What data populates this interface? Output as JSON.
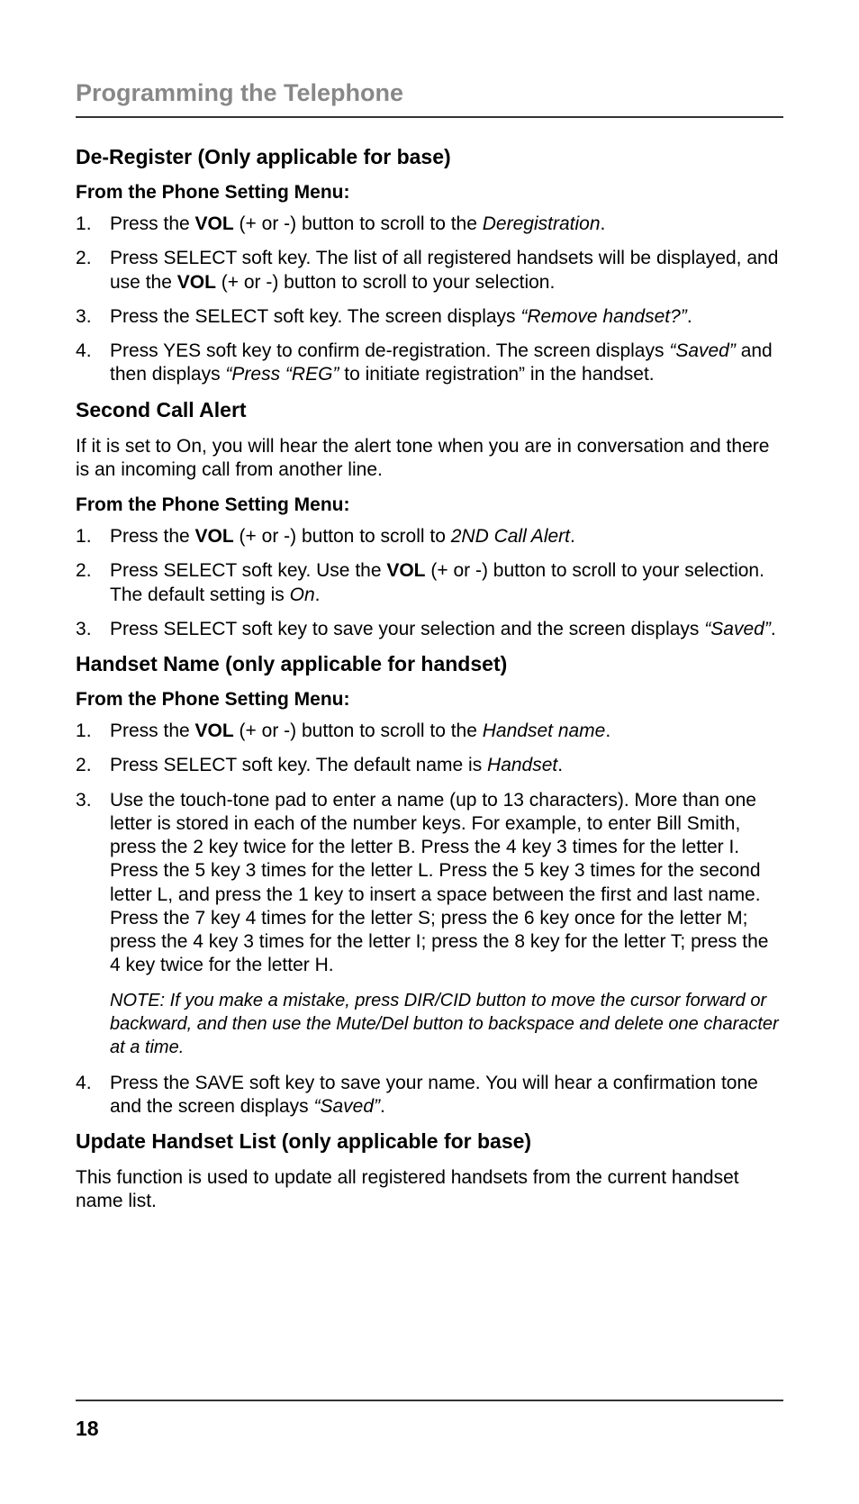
{
  "header": "Programming the Telephone",
  "section1": {
    "title": "De-Register (Only applicable for base)",
    "subhead": "From the Phone Setting Menu:",
    "s1_pre": "Press the ",
    "s1_vol": "VOL",
    "s1_mid": " (+ or -) button to scroll to the ",
    "s1_ital": "Deregistration",
    "s1_end": ".",
    "s2_pre": "Press SELECT soft key. The list of all registered handsets will be displayed, and use the ",
    "s2_vol": "VOL",
    "s2_end": " (+ or -) button to scroll to your selection.",
    "s3_pre": "Press the SELECT soft key. The screen displays ",
    "s3_ital": "“Remove handset?”",
    "s3_end": ".",
    "s4_pre": "Press YES soft key to confirm de-registration. The screen displays ",
    "s4_i1": "“Saved”",
    "s4_mid": " and then displays ",
    "s4_i2": "“Press “REG”",
    "s4_end": " to initiate registration” in the handset."
  },
  "section2": {
    "title": "Second Call Alert",
    "intro": "If it is set to On, you will hear the alert tone when you are in conversation and there is an incoming call from another line.",
    "subhead": "From the Phone Setting Menu:",
    "s1_pre": "Press the ",
    "s1_vol": "VOL",
    "s1_mid": " (+ or -) button to scroll to ",
    "s1_ital": "2ND Call Alert",
    "s1_end": ".",
    "s2_pre": "Press SELECT soft key. Use the ",
    "s2_vol": "VOL",
    "s2_mid": " (+ or -) button to scroll to your selection. The default setting is ",
    "s2_ital": "On",
    "s2_end": ".",
    "s3_pre": "Press SELECT soft key to save your selection and the screen displays ",
    "s3_ital": "“Saved”",
    "s3_end": "."
  },
  "section3": {
    "title": "Handset Name (only applicable for handset)",
    "subhead": "From the Phone Setting Menu:",
    "s1_pre": "Press the ",
    "s1_vol": "VOL",
    "s1_mid": " (+ or -) button to scroll to the ",
    "s1_ital": "Handset name",
    "s1_end": ".",
    "s2_pre": "Press SELECT soft key. The default name is ",
    "s2_ital": "Handset",
    "s2_end": ".",
    "s3": "Use the touch-tone pad to enter a name (up to 13 characters). More than one letter is stored in each of the number keys. For example, to enter Bill Smith, press the 2 key twice for the letter B. Press the 4 key 3 times for the letter I. Press the 5 key 3 times for the letter L. Press the 5 key 3 times for the second letter L, and press the 1 key to insert a space between the first and last name. Press the 7 key 4 times for the letter S; press the 6 key once for the letter M; press the 4 key 3 times for the letter I; press the 8 key for the letter T; press the 4 key twice for the letter H.",
    "note": "NOTE: If you make a mistake, press DIR/CID button to move the cursor forward or backward, and then use the Mute/Del button to backspace and delete one character at a time.",
    "s4_pre": "Press the SAVE soft key to save your name. You will hear a confirmation tone and the screen displays ",
    "s4_ital": "“Saved”",
    "s4_end": "."
  },
  "section4": {
    "title": "Update Handset List (only applicable for base)",
    "intro": "This function is used to update all registered handsets from the current handset name list."
  },
  "pageNumber": "18"
}
